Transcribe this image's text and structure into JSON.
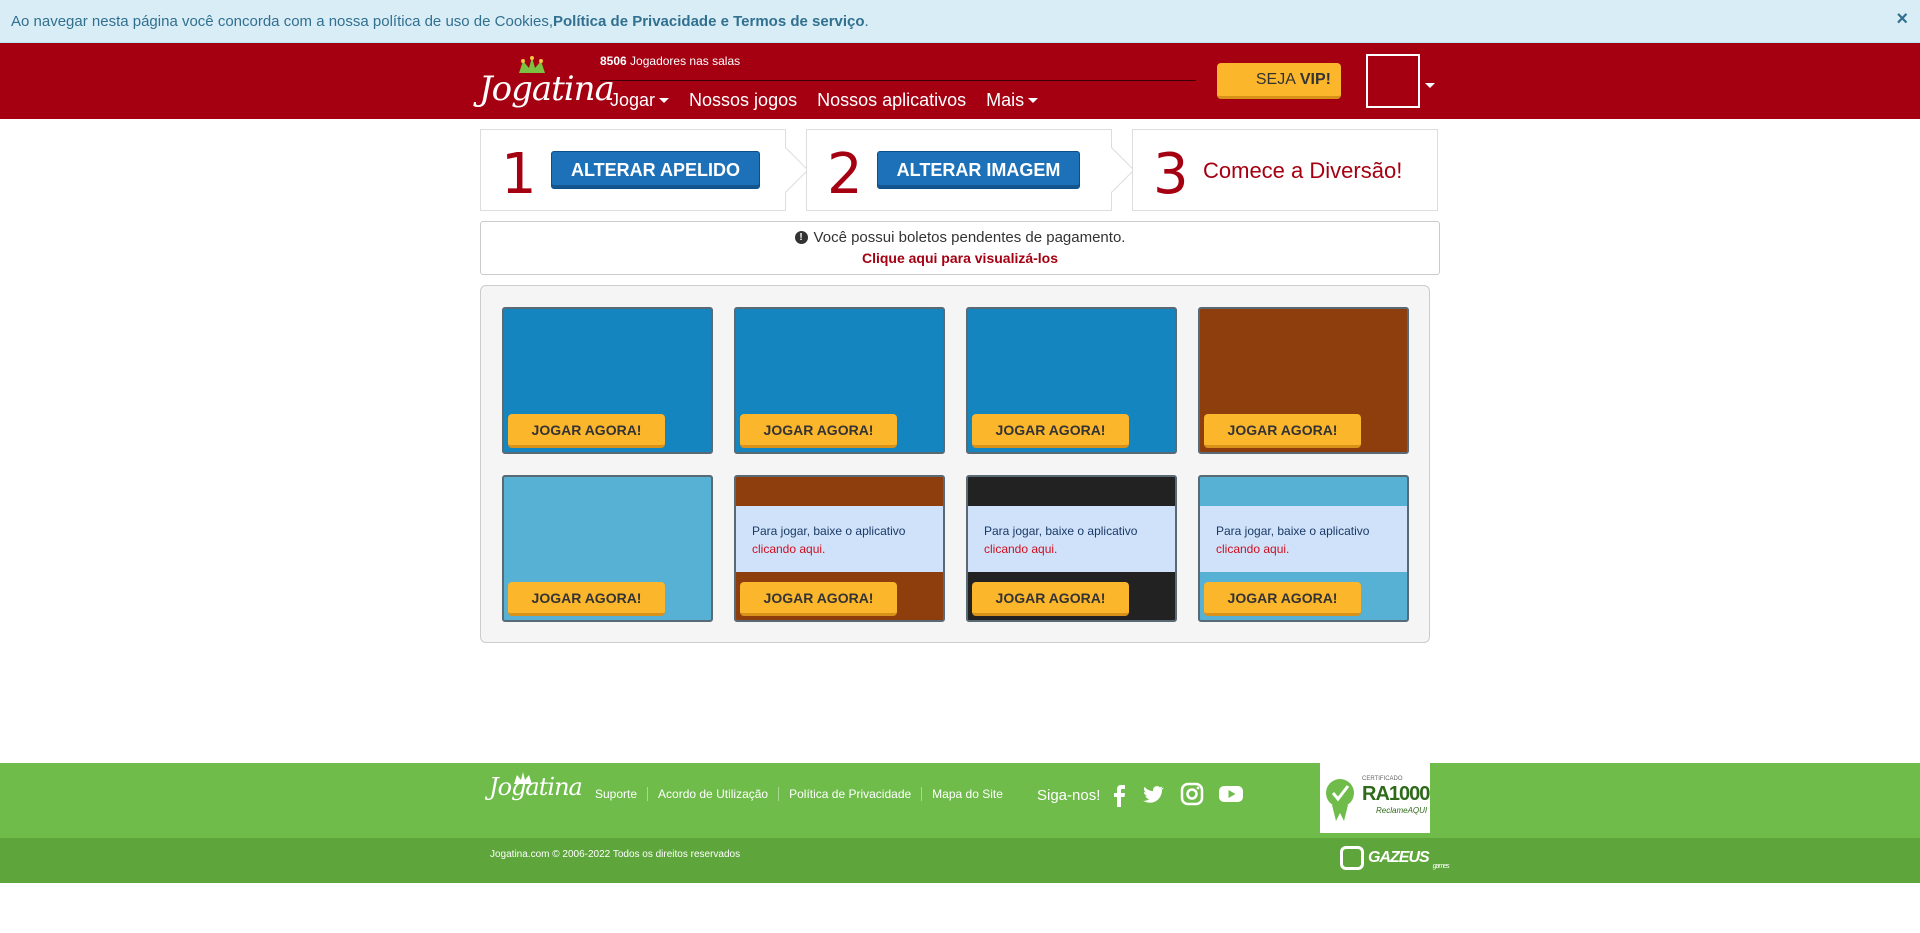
{
  "cookie": {
    "text": "Ao navegar nesta página você concorda com a nossa política de uso de Cookies, ",
    "link": "Política de Privacidade e Termos de serviço",
    "suffix": ".",
    "close": "×"
  },
  "header": {
    "logo": "Jogatina",
    "players_count": "8506",
    "players_label": "Jogadores nas salas",
    "nav": [
      "Jogar",
      "Nossos jogos",
      "Nossos aplicativos",
      "Mais"
    ],
    "vip_prefix": "SEJA",
    "vip_bold": "VIP!"
  },
  "steps": [
    {
      "number": "1",
      "label": "ALTERAR APELIDO"
    },
    {
      "number": "2",
      "label": "ALTERAR IMAGEM"
    },
    {
      "number": "3",
      "label": "Comece a Diversão!"
    }
  ],
  "alert": {
    "icon": "!",
    "message": "Você possui boletos pendentes de pagamento.",
    "link": "Clique aqui para visualizá-los"
  },
  "games": [
    {
      "color": "#1485bf",
      "play": "JOGAR AGORA!",
      "overlay": false
    },
    {
      "color": "#1485bf",
      "play": "JOGAR AGORA!",
      "overlay": false
    },
    {
      "color": "#1485bf",
      "play": "JOGAR AGORA!",
      "overlay": false
    },
    {
      "color": "#8e3d0d",
      "play": "JOGAR AGORA!",
      "overlay": false
    },
    {
      "color": "#56b1d5",
      "play": "JOGAR AGORA!",
      "overlay": false
    },
    {
      "color": "#8e3d0d",
      "play": "JOGAR AGORA!",
      "overlay": true
    },
    {
      "color": "#222222",
      "play": "JOGAR AGORA!",
      "overlay": true
    },
    {
      "color": "#56b1d5",
      "play": "JOGAR AGORA!",
      "overlay": true
    }
  ],
  "app_overlay": {
    "text": "Para jogar, baixe o aplicativo",
    "link": "clicando aqui."
  },
  "footer": {
    "logo": "Jogatina",
    "links": [
      "Suporte",
      "Acordo de Utilização",
      "Política de Privacidade",
      "Mapa do Site"
    ],
    "follow": "Siga-nos!",
    "social": [
      "facebook-icon",
      "twitter-icon",
      "instagram-icon",
      "youtube-icon"
    ],
    "badge_cert": "CERTIFICADO",
    "badge_main": "RA1000",
    "badge_sub": "ReclameAQUI",
    "copyright": "Jogatina.com © 2006-2022 Todos os direitos reservados",
    "gazeus": "GAZEUS",
    "gazeus_sub": "games"
  },
  "colors": {
    "brand_red": "#a50011",
    "button_blue": "#1c71b8",
    "play_yellow": "#fbb62b",
    "footer_green": "#6fbc4b"
  }
}
